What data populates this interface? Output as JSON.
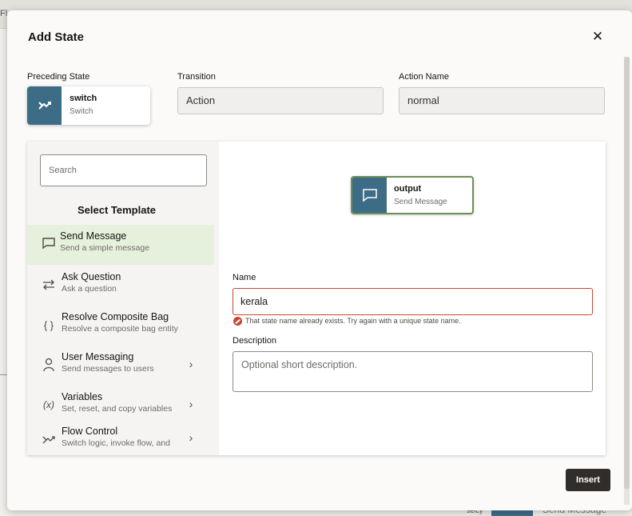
{
  "background": {
    "fragment_left": "Fl",
    "bottom_label": "selcy",
    "bottom_message": "Send Message"
  },
  "dialog": {
    "title": "Add State",
    "close_icon": "close-icon"
  },
  "fields": {
    "preceding_state": {
      "label": "Preceding State",
      "name": "switch",
      "type": "Switch",
      "icon": "switch-icon"
    },
    "transition": {
      "label": "Transition",
      "value": "Action"
    },
    "action_name": {
      "label": "Action Name",
      "value": "normal"
    }
  },
  "search": {
    "placeholder": "Search"
  },
  "templates": {
    "heading": "Select Template",
    "items": [
      {
        "title": "Send Message",
        "subtitle": "Send a simple message",
        "icon": "chat-bubble-icon",
        "selected": true
      },
      {
        "title": "Ask Question",
        "subtitle": "Ask a question",
        "icon": "swap-arrows-icon"
      },
      {
        "title": "Resolve Composite Bag",
        "subtitle": "Resolve a composite bag entity",
        "icon": "braces-icon"
      },
      {
        "title": "User Messaging",
        "subtitle": "Send messages to users",
        "icon": "user-icon",
        "has_submenu": true
      },
      {
        "title": "Variables",
        "subtitle": "Set, reset, and copy variables",
        "icon": "variable-icon",
        "has_submenu": true
      },
      {
        "title": "Flow Control",
        "subtitle": "Switch logic, invoke flow, and",
        "icon": "flow-icon",
        "has_submenu": true
      }
    ]
  },
  "preview_node": {
    "name": "output",
    "type": "Send Message",
    "icon": "chat-bubble-icon"
  },
  "form": {
    "name_label": "Name",
    "name_value": "kerala",
    "error_text": "That state name already exists. Try again with a unique state name.",
    "description_label": "Description",
    "description_placeholder": "Optional short description."
  },
  "actions": {
    "insert_label": "Insert"
  },
  "colors": {
    "icon_bg": "#3d6d86",
    "selected_bg": "#e5f1dd",
    "error": "#c74634",
    "primary_button": "#312d2a",
    "node_border": "#6e8e58"
  }
}
